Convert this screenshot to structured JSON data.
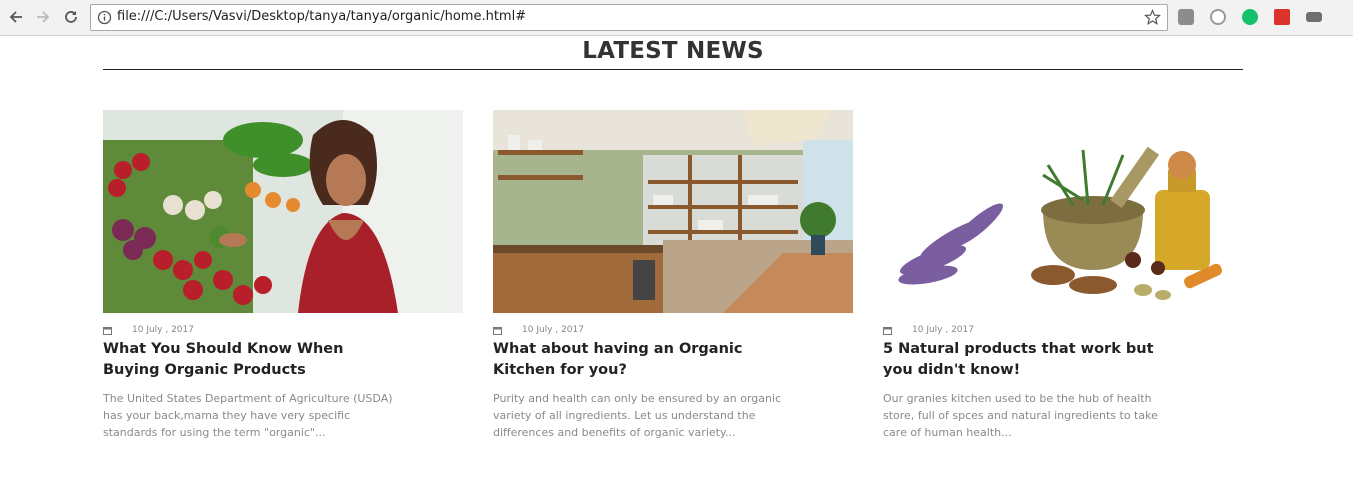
{
  "browser": {
    "url": "file:///C:/Users/Vasvi/Desktop/tanya/tanya/organic/home.html#",
    "back_icon": "back-arrow-icon",
    "forward_icon": "forward-arrow-icon",
    "reload_icon": "reload-icon",
    "extensions": [
      "pocket-icon",
      "skype-icon",
      "grammarly-icon",
      "bookmark-red-icon",
      "extension-grey-icon"
    ]
  },
  "section": {
    "heading": "LATEST NEWS"
  },
  "articles": [
    {
      "date": "10 July , 2017",
      "title": "What You Should Know When Buying Organic Products",
      "excerpt": "The United States Department of Agriculture (USDA) has your back,mama they have very specific standards for using the term \"organic\"..."
    },
    {
      "date": "10 July , 2017",
      "title": "What about having an Organic Kitchen for you?",
      "excerpt": "Purity and health can only be ensured by an organic variety of all ingredients. Let us understand the differences and benefits of organic variety..."
    },
    {
      "date": "10 July , 2017",
      "title": "5 Natural products that work but you didn't know!",
      "excerpt": "Our granies kitchen used to be the hub of health store, full of spces and natural ingredients to take care of human health..."
    }
  ],
  "colors": {
    "heading": "#333333",
    "title": "#222222",
    "excerpt": "#8a8a8a",
    "date": "#888888"
  }
}
